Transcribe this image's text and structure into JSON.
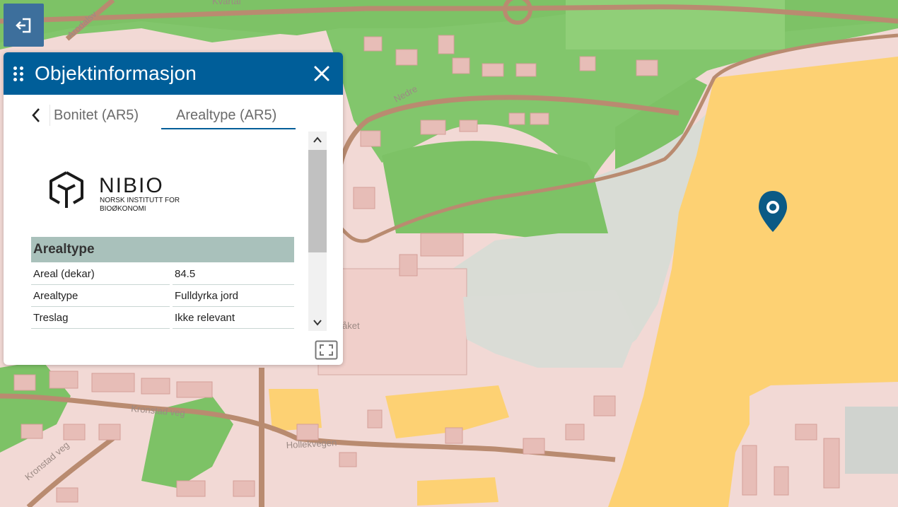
{
  "panel": {
    "title": "Objektinformasjon",
    "tabs": [
      {
        "label": "Bonitet (AR5)",
        "active": false
      },
      {
        "label": "Arealtype (AR5)",
        "active": true
      }
    ],
    "logo": {
      "name": "NIBIO",
      "line1": "NORSK INSTITUTT FOR",
      "line2": "BIOØKONOMI"
    },
    "table": {
      "heading": "Arealtype",
      "rows": [
        {
          "key": "Areal (dekar)",
          "value": "84.5"
        },
        {
          "key": "Arealtype",
          "value": "Fulldyrka jord"
        },
        {
          "key": "Treslag",
          "value": "Ikke relevant"
        }
      ]
    }
  },
  "map": {
    "labels": {
      "kvartal": "Kvartal",
      "arodalsv": "Arodalsv",
      "nedre": "Nedre",
      "kronstad": "Kronstad veg",
      "kronstad2": "Kronstad veg",
      "hollek": "Hollekvegen",
      "braket": "åket"
    },
    "colors": {
      "built": "#f4d7d3",
      "green": "#7fc46a",
      "farmland": "#fdd173",
      "road": "#b88b70",
      "grey": "#d9dbd6",
      "marker": "#0b5a85"
    }
  },
  "icons": {
    "exit": "exit-arrow-icon",
    "close": "close-icon",
    "back": "chevron-left-icon",
    "marker": "map-pin-icon",
    "expand": "expand-icon"
  }
}
